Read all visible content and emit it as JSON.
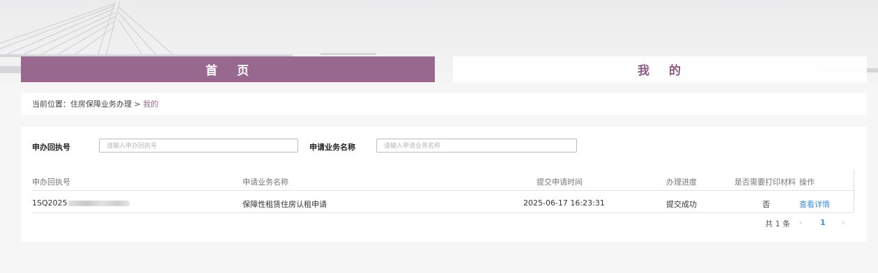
{
  "nav": {
    "home": "首 页",
    "mine": "我 的"
  },
  "breadcrumb": {
    "prefix": "当前位置：住房保障业务办理 > ",
    "current": "我的"
  },
  "search": {
    "receipt_label": "申办回执号",
    "receipt_placeholder": "请输入申办回执号",
    "business_label": "申请业务名称",
    "business_placeholder": "请输入申请业务名称"
  },
  "table": {
    "headers": [
      "申办回执号",
      "申请业务名称",
      "提交申请时间",
      "办理进度",
      "是否需要打印材料",
      "操作"
    ],
    "rows": [
      {
        "receipt": "1SQ2025",
        "business": "保障性租赁住房认租申请",
        "time": "2025-06-17 16:23:31",
        "progress": "提交成功",
        "print": "否",
        "action": "查看详情"
      }
    ]
  },
  "pagination": {
    "total": "共 1 条",
    "prev": "‹",
    "page": "1",
    "next": "›"
  },
  "colors": {
    "accent": "#98688f",
    "link": "#3a8de0"
  }
}
